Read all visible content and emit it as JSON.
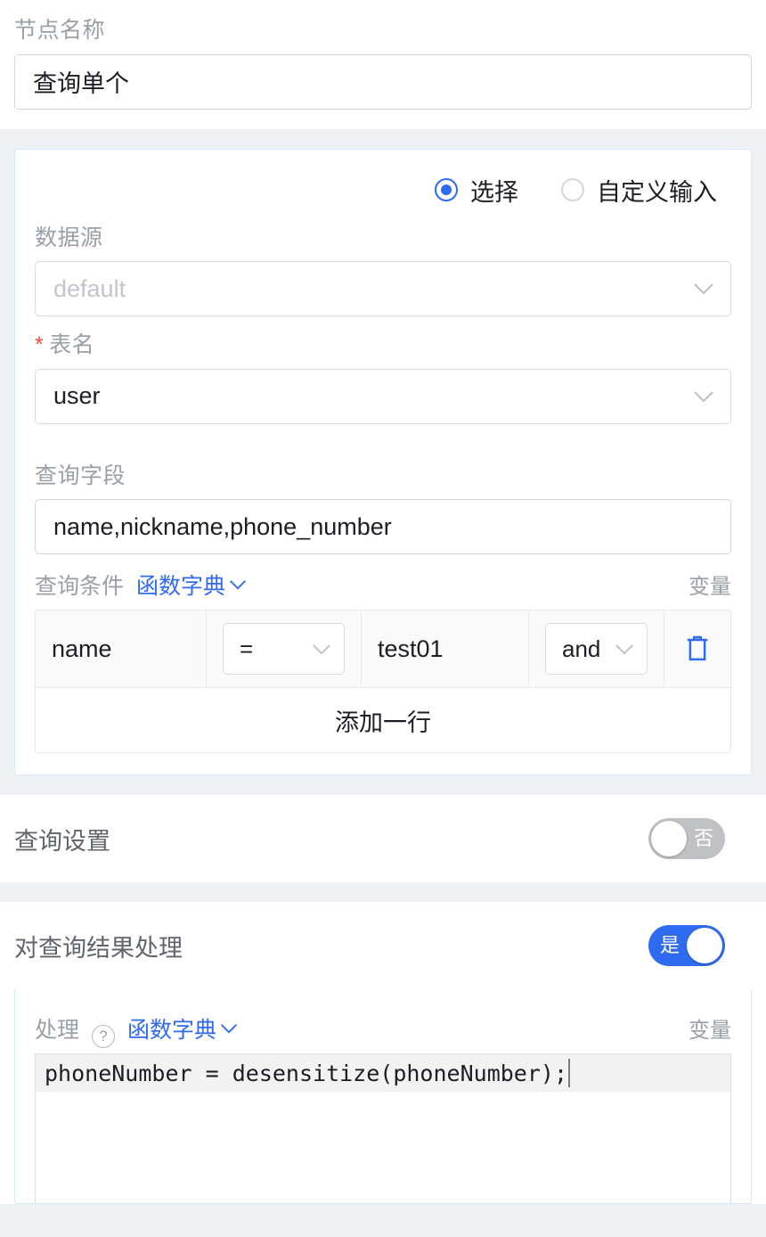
{
  "node": {
    "label": "节点名称",
    "value": "查询单个"
  },
  "source_mode": {
    "option_select": "选择",
    "option_custom": "自定义输入",
    "selected": "选择"
  },
  "datasource": {
    "label": "数据源",
    "placeholder": "default",
    "value": "default",
    "chevron_icon": "chevron-down-icon"
  },
  "table": {
    "label": "表名",
    "required_mark": "*",
    "value": "user",
    "chevron_icon": "chevron-down-icon"
  },
  "fields": {
    "label": "查询字段",
    "value": "name,nickname,phone_number"
  },
  "conditions": {
    "label": "查询条件",
    "fn_dict_link": "函数字典",
    "fn_dict_chevron": "chevron-down-icon",
    "variable_label": "变量",
    "rows": [
      {
        "field": "name",
        "operator": "=",
        "value": "test01",
        "join": "and",
        "delete_icon": "trash-icon"
      }
    ],
    "add_row_label": "添加一行"
  },
  "query_settings": {
    "title": "查询设置",
    "toggle_state": "off",
    "toggle_text": "否"
  },
  "result_processing": {
    "title": "对查询结果处理",
    "toggle_state": "on",
    "toggle_text": "是",
    "process_label": "处理",
    "help_icon": "question-mark-icon",
    "fn_dict_link": "函数字典",
    "fn_dict_chevron": "chevron-down-icon",
    "variable_label": "变量",
    "code": "phoneNumber = desensitize(phoneNumber);"
  },
  "colors": {
    "accent": "#2f6bf0",
    "required": "#f5483b",
    "muted": "#9aa0a8",
    "page_bg": "#eef0f4",
    "card_border": "#dae8fb"
  }
}
